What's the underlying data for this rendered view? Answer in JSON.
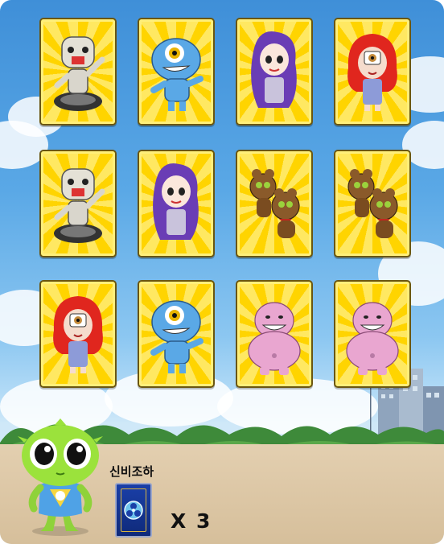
{
  "board": {
    "cards": [
      {
        "character": "skeleton-robot",
        "face_up": true
      },
      {
        "character": "blue-cyclops",
        "face_up": true
      },
      {
        "character": "purple-hair-girl",
        "face_up": true
      },
      {
        "character": "red-hair-cyclops-girl",
        "face_up": true
      },
      {
        "character": "skeleton-robot",
        "face_up": true
      },
      {
        "character": "purple-hair-girl",
        "face_up": true
      },
      {
        "character": "brown-twin-bears",
        "face_up": true
      },
      {
        "character": "brown-twin-bears",
        "face_up": true
      },
      {
        "character": "red-hair-cyclops-girl",
        "face_up": true
      },
      {
        "character": "blue-cyclops",
        "face_up": true
      },
      {
        "character": "pink-fat-monster",
        "face_up": true
      },
      {
        "character": "pink-fat-monster",
        "face_up": true
      }
    ]
  },
  "item": {
    "label": "신비조하",
    "count_text": "X 3"
  },
  "colors": {
    "card_gold": "#ffd400",
    "item_card_blue": "#1a3fa8",
    "mascot_green": "#9be23c"
  }
}
